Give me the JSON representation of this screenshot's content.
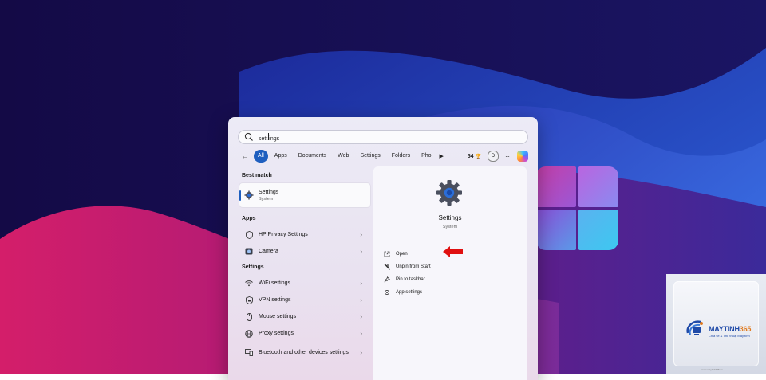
{
  "search": {
    "query_before_caret": "sett",
    "query_after_caret": "ings"
  },
  "filters": {
    "back_label": "←",
    "chips": [
      "All",
      "Apps",
      "Documents",
      "Web",
      "Settings",
      "Folders",
      "Pho"
    ],
    "count": "54",
    "avatar_letter": "D",
    "more_label": "···"
  },
  "best_match": {
    "heading": "Best match",
    "title": "Settings",
    "subtitle": "System"
  },
  "apps": {
    "heading": "Apps",
    "items": [
      {
        "label": "HP Privacy Settings",
        "icon": "shield-icon"
      },
      {
        "label": "Camera",
        "icon": "camera-icon"
      }
    ]
  },
  "settings": {
    "heading": "Settings",
    "items": [
      {
        "label": "WiFi settings",
        "icon": "wifi-icon"
      },
      {
        "label": "VPN settings",
        "icon": "vpn-shield-icon"
      },
      {
        "label": "Mouse settings",
        "icon": "mouse-icon"
      },
      {
        "label": "Proxy settings",
        "icon": "globe-icon"
      },
      {
        "label": "Bluetooth and other devices settings",
        "icon": "bluetooth-icon"
      }
    ]
  },
  "detail": {
    "title": "Settings",
    "subtitle": "System",
    "actions": [
      {
        "label": "Open",
        "icon": "open-external-icon"
      },
      {
        "label": "Unpin from Start",
        "icon": "unpin-icon"
      },
      {
        "label": "Pin to taskbar",
        "icon": "pin-icon"
      },
      {
        "label": "App settings",
        "icon": "gear-icon"
      }
    ]
  },
  "watermark": {
    "brand_main": "MAYTINH",
    "brand_accent": "365",
    "tagline": "Chia sẻ & Thủ thuật Máy tính",
    "url": "www.maytinh365.vn"
  },
  "colors": {
    "accent": "#1f5fbf",
    "arrow": "#e01010",
    "bg_dark": "#150c4a",
    "bg_blue": "#2a5cd6",
    "bg_pink": "#c4196e"
  }
}
